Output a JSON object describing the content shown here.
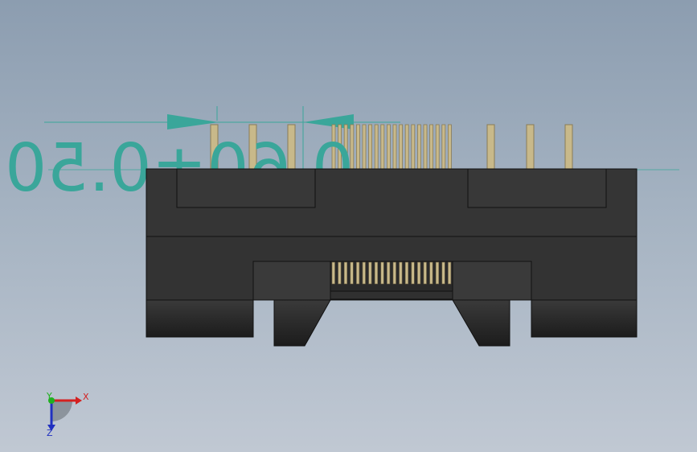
{
  "dimension": {
    "value_text": "0.60±0.50",
    "color": "#3aa69a"
  },
  "triad": {
    "x_label": "X",
    "y_label": "Y",
    "z_label": "Z",
    "x_color": "#d42020",
    "y_color": "#20b020",
    "z_color": "#2030c0"
  },
  "model": {
    "body_color": "#353535",
    "pin_color": "#c8b98a",
    "top_pin_count": 20,
    "bottom_pin_count": 20
  }
}
